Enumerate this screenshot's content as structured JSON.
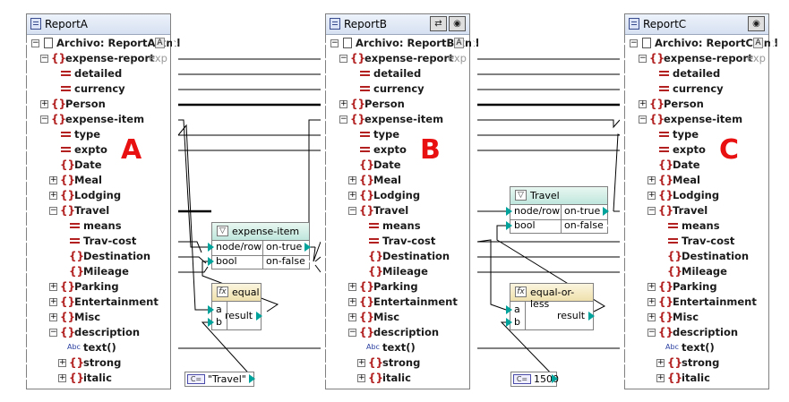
{
  "components": [
    {
      "id": "A",
      "name": "ReportA",
      "file": "Archivo: ReportA.xml",
      "file_button": "A",
      "buttons": [],
      "big_label": "A",
      "root_label": "expense-report",
      "root_suffix": "expen"
    },
    {
      "id": "B",
      "name": "ReportB",
      "file": "Archivo: ReportB.xml",
      "file_button": "A",
      "buttons": [
        "link-icon",
        "eye-icon"
      ],
      "big_label": "B",
      "root_label": "expense-report",
      "root_suffix": "expen"
    },
    {
      "id": "C",
      "name": "ReportC",
      "file": "Archivo: ReportC.xml",
      "file_button": "A",
      "buttons": [
        "eye-icon"
      ],
      "big_label": "C",
      "root_label": "expense-report",
      "root_suffix": "expen"
    }
  ],
  "tree_items": [
    {
      "label": "detailed",
      "kind": "attribute",
      "level": 2,
      "toggle": ""
    },
    {
      "label": "currency",
      "kind": "attribute",
      "level": 2,
      "toggle": ""
    },
    {
      "label": "Person",
      "kind": "element",
      "level": 1,
      "toggle": "+"
    },
    {
      "label": "expense-item",
      "kind": "element",
      "level": 1,
      "toggle": "-"
    },
    {
      "label": "type",
      "kind": "attribute",
      "level": 2,
      "toggle": ""
    },
    {
      "label": "expto",
      "kind": "attribute",
      "level": 2,
      "toggle": ""
    },
    {
      "label": "Date",
      "kind": "element",
      "level": 2,
      "toggle": ""
    },
    {
      "label": "Meal",
      "kind": "element",
      "level": 2,
      "toggle": "+"
    },
    {
      "label": "Lodging",
      "kind": "element",
      "level": 2,
      "toggle": "+"
    },
    {
      "label": "Travel",
      "kind": "element",
      "level": 2,
      "toggle": "-"
    },
    {
      "label": "means",
      "kind": "attribute",
      "level": 3,
      "toggle": ""
    },
    {
      "label": "Trav-cost",
      "kind": "attribute",
      "level": 3,
      "toggle": ""
    },
    {
      "label": "Destination",
      "kind": "element",
      "level": 3,
      "toggle": ""
    },
    {
      "label": "Mileage",
      "kind": "element",
      "level": 3,
      "toggle": ""
    },
    {
      "label": "Parking",
      "kind": "element",
      "level": 2,
      "toggle": "+"
    },
    {
      "label": "Entertainment",
      "kind": "element",
      "level": 2,
      "toggle": "+"
    },
    {
      "label": "Misc",
      "kind": "element",
      "level": 2,
      "toggle": "+"
    },
    {
      "label": "description",
      "kind": "element",
      "level": 2,
      "toggle": "-"
    },
    {
      "label": "text()",
      "kind": "text",
      "level": 3,
      "toggle": ""
    },
    {
      "label": "strong",
      "kind": "element",
      "level": 3,
      "toggle": "+"
    },
    {
      "label": "italic",
      "kind": "element",
      "level": 3,
      "toggle": "+"
    }
  ],
  "filters": [
    {
      "id": "filter-1",
      "title": "expense-item",
      "inputs": [
        "node/row",
        "bool"
      ],
      "outputs": [
        "on-true",
        "on-false"
      ]
    },
    {
      "id": "filter-2",
      "title": "Travel",
      "inputs": [
        "node/row",
        "bool"
      ],
      "outputs": [
        "on-true",
        "on-false"
      ]
    }
  ],
  "functions": [
    {
      "id": "func-1",
      "title": "equal",
      "inputs": [
        "a",
        "b"
      ],
      "output": "result",
      "icon": "function-icon"
    },
    {
      "id": "func-2",
      "title": "equal-or-less",
      "inputs": [
        "a",
        "b"
      ],
      "output": "result",
      "icon": "function-icon"
    }
  ],
  "constants": [
    {
      "id": "const-1",
      "icon": "C=",
      "value": "\"Travel\""
    },
    {
      "id": "const-2",
      "icon": "C=",
      "value": "1500"
    }
  ],
  "colors": {
    "title_bar": "#d5e0f1",
    "filter_title": "#bfe6dc",
    "function_title": "#efe0ac",
    "element_icon": "#b22020",
    "port_connected": "#00a39b",
    "big_label": "#e81010",
    "line": "#000000"
  }
}
